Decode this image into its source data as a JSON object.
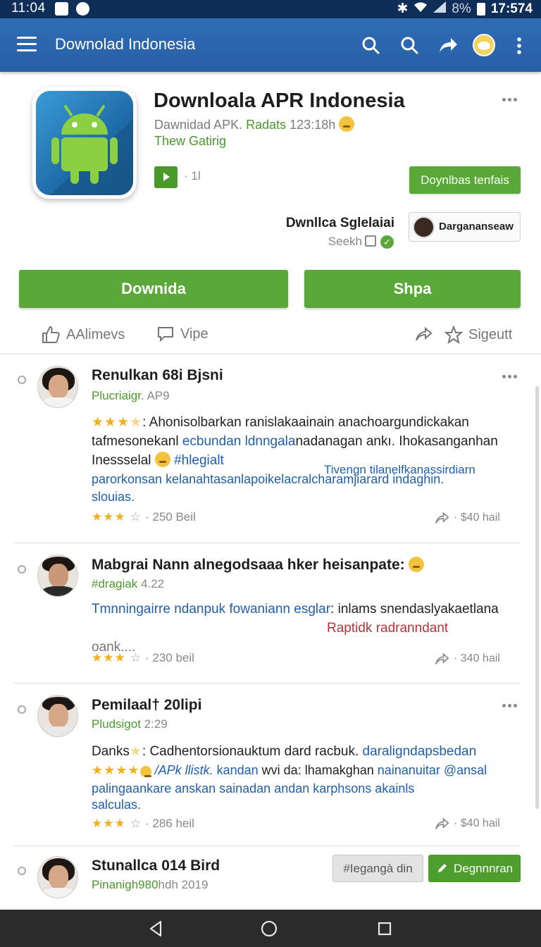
{
  "status_bar": {
    "time": "11:04",
    "battery": "8%",
    "clock": "17:574"
  },
  "app_bar": {
    "title": "Downolad Indonesia"
  },
  "app": {
    "name": "Downloala APR Indonesia",
    "sub_prefix": "Dawnidad APK.",
    "sub_green": "Radats",
    "sub_suffix": "123:18h",
    "developer": "Thew Gatirig",
    "play_count": "· 1l",
    "details_button": "Doynlbas tenfais",
    "seller_name": "Dwnllca Sglelaiai",
    "seller_sub": "Seekh",
    "profile_chip": "Dargananseaw"
  },
  "buttons": {
    "primary": "Downida",
    "secondary": "Shpa"
  },
  "actions": {
    "like": "AAlimevs",
    "view": "Vipe",
    "save": "Sigeutt"
  },
  "reviews": [
    {
      "name": "Renulkan 68i Bjsni",
      "meta": "Plucriaigr.",
      "meta_gray": "AP9",
      "line1_stars": "★★★",
      "line1_half": "★",
      "line1": ": Ahonisolbarkan ranislakaainain anachoargundickakan",
      "line2_a": "tafmesonekanl",
      "line2_blue": "ecbundan ldnngala",
      "line2_b": "nadanagan ankı. Ihokasanganhan",
      "line3_a": "Inessselal",
      "line3_tag": "#hlegialt",
      "line3_right": "Tivengn tilanelfkanassirdiarn",
      "line4": "parorkonsan kelanahtasanlapoikelacralcharamjiarard indaghin.",
      "line5": "slouias.",
      "foot_stars": "★★★",
      "foot_empty": "☆",
      "foot_count": "· 250 Beil",
      "share": "· $40 hail"
    },
    {
      "name": "Mabgrai Nann alnegodsaaa hker heisanpate:",
      "meta": "#dragiak",
      "meta_gray": "4.22",
      "line1_blue": "Tmnningairre ndanpuk fowaniann esglar",
      "line1": ": inlams snendaslyakaetlana",
      "line2_red": "Raptidk radranndant",
      "line3": "oank....",
      "foot_stars": "★★★",
      "foot_empty": "☆",
      "foot_count": "· 230 beil",
      "share": "· 340 hail"
    },
    {
      "name": "Pemilaal† 20lipi",
      "meta": "Pludsigot",
      "meta_gray": "2:29",
      "line1_a": "Danks",
      "line1_b": ": Cadhentorsionauktum dard racbuk.",
      "line1_blue": "daraligndapsbedan",
      "line2_stars": "★★★★",
      "line2_blue_a": "/APk llistk.",
      "line2_b": "kandan",
      "line2_c": "wvi da: lhamakghan",
      "line2_blue_b": "nainanuitar @ansal",
      "line3": "palingaankare anskan sainadan andan karphsons akainls",
      "line4": "salculas.",
      "foot_stars": "★★★",
      "foot_empty": "☆",
      "foot_count": "· 286 heil",
      "share": "· $40 hail"
    },
    {
      "name": "Stunallca 014 Bird",
      "meta": "Pinanigh980",
      "meta_gray": "hdh 2019",
      "tag_button": "#Iegangà din",
      "design_button": "Degnnnran"
    }
  ],
  "colors": {
    "app_bar": "#2f6cb5",
    "green": "#5aa938",
    "status_bar": "#0e2d57",
    "star": "#f0b21c"
  }
}
